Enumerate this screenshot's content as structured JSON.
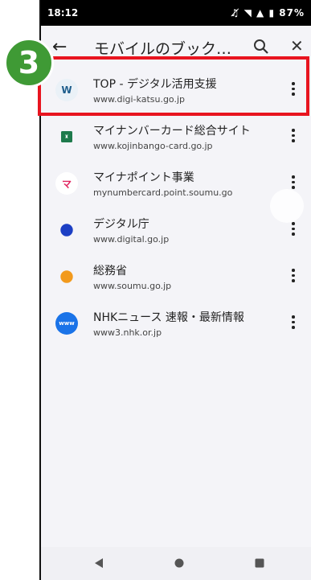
{
  "status_bar": {
    "time": "18:12",
    "battery": "87%"
  },
  "app_bar": {
    "title": "モバイルのブック…"
  },
  "step_badge": "3",
  "bookmarks": [
    {
      "title": "TOP - デジタル活用支援",
      "url": "www.digi-katsu.go.jp",
      "icon": "wordpress-icon",
      "icon_color": "#1f5e8c",
      "icon_bg": "#eaf1f7",
      "glyph": "W"
    },
    {
      "title": "マイナンバーカード総合サイト",
      "url": "www.kojinbango-card.go.jp",
      "icon": "card-site-icon",
      "icon_color": "#ffffff",
      "icon_bg": "#1e7a4c",
      "glyph": "♜"
    },
    {
      "title": "マイナポイント事業",
      "url": "mynumbercard.point.soumu.go",
      "icon": "mynapoint-icon",
      "icon_color": "#e0245e",
      "icon_bg": "#ffffff",
      "glyph": "マ"
    },
    {
      "title": "デジタル庁",
      "url": "www.digital.go.jp",
      "icon": "digital-agency-icon",
      "icon_color": "#1c3fc4",
      "icon_bg": "#1c3fc4",
      "glyph": ""
    },
    {
      "title": "総務省",
      "url": "www.soumu.go.jp",
      "icon": "soumu-icon",
      "icon_color": "#f29a1d",
      "icon_bg": "#f29a1d",
      "glyph": ""
    },
    {
      "title": "NHKニュース 速報・最新情報",
      "url": "www3.nhk.or.jp",
      "icon": "www-icon",
      "icon_color": "#ffffff",
      "icon_bg": "#1a73e8",
      "glyph": "www"
    }
  ]
}
